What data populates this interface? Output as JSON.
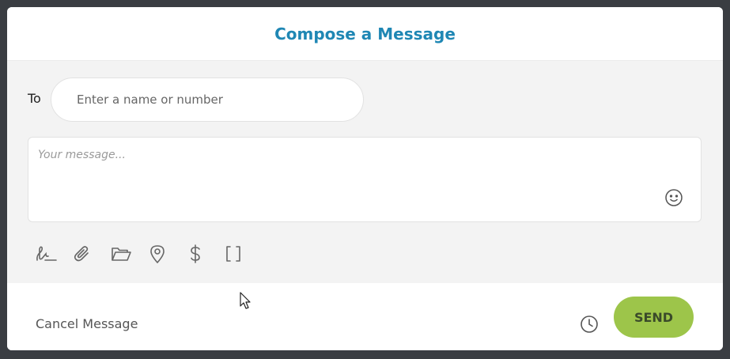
{
  "dialog": {
    "title": "Compose a Message"
  },
  "to": {
    "label": "To",
    "placeholder": "Enter a name or number",
    "value": ""
  },
  "message": {
    "placeholder": "Your message...",
    "value": ""
  },
  "toolbar": {
    "icons": [
      "signature-icon",
      "paperclip-icon",
      "folder-icon",
      "location-pin-icon",
      "dollar-icon",
      "brackets-icon"
    ]
  },
  "footer": {
    "cancel_label": "Cancel Message",
    "send_label": "SEND"
  },
  "colors": {
    "accent": "#1f87b4",
    "send": "#9dc54a",
    "body_bg": "#f3f3f3",
    "backdrop": "#3a3d42"
  }
}
